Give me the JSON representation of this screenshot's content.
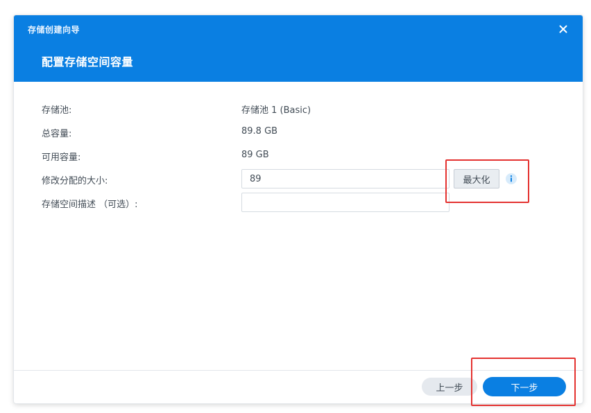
{
  "window": {
    "title": "存储创建向导",
    "close_icon": "close-icon"
  },
  "page": {
    "title": "配置存储空间容量"
  },
  "form": {
    "pool_label": "存储池:",
    "pool_value": "存储池 1 (Basic)",
    "total_label": "总容量:",
    "total_value": "89.8 GB",
    "available_label": "可用容量:",
    "available_value": "89 GB",
    "size_label": "修改分配的大小:",
    "size_value": "89",
    "max_button_label": "最大化",
    "info_icon": "info-icon",
    "description_label": "存储空间描述 （可选）:",
    "description_value": ""
  },
  "footer": {
    "prev_label": "上一步",
    "next_label": "下一步"
  },
  "colors": {
    "header_blue": "#0a7fe2",
    "primary_button": "#0a7fe2",
    "secondary_button": "#e5e9ee",
    "annotation_red": "#e4312f",
    "text": "#414b55"
  }
}
